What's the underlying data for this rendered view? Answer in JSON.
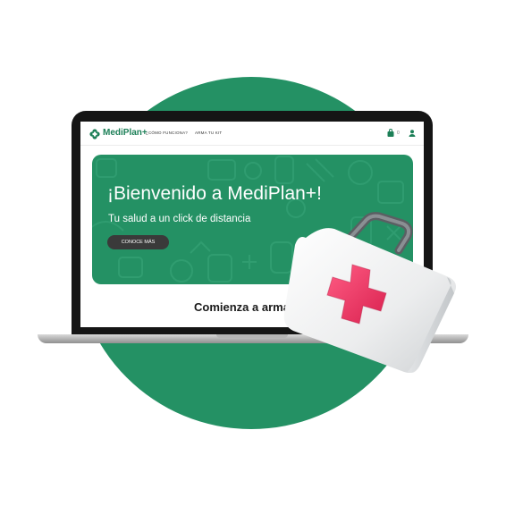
{
  "brand": {
    "name": "MediPlan+",
    "color": "#1c7f57"
  },
  "nav": {
    "links": [
      "¿CÓMO FUNCIONA?",
      "ARMA TU KIT"
    ],
    "cart_count": "0"
  },
  "hero": {
    "title": "¡Bienvenido a MediPlan+!",
    "subtitle": "Tu salud a un click de distancia",
    "button": "CONOCE MÁS",
    "color": "#249164"
  },
  "section": {
    "title": "Comienza a armar"
  },
  "icons": [
    "medical-cross-logo-icon",
    "cart-icon",
    "user-icon",
    "first-aid-kit-icon"
  ]
}
